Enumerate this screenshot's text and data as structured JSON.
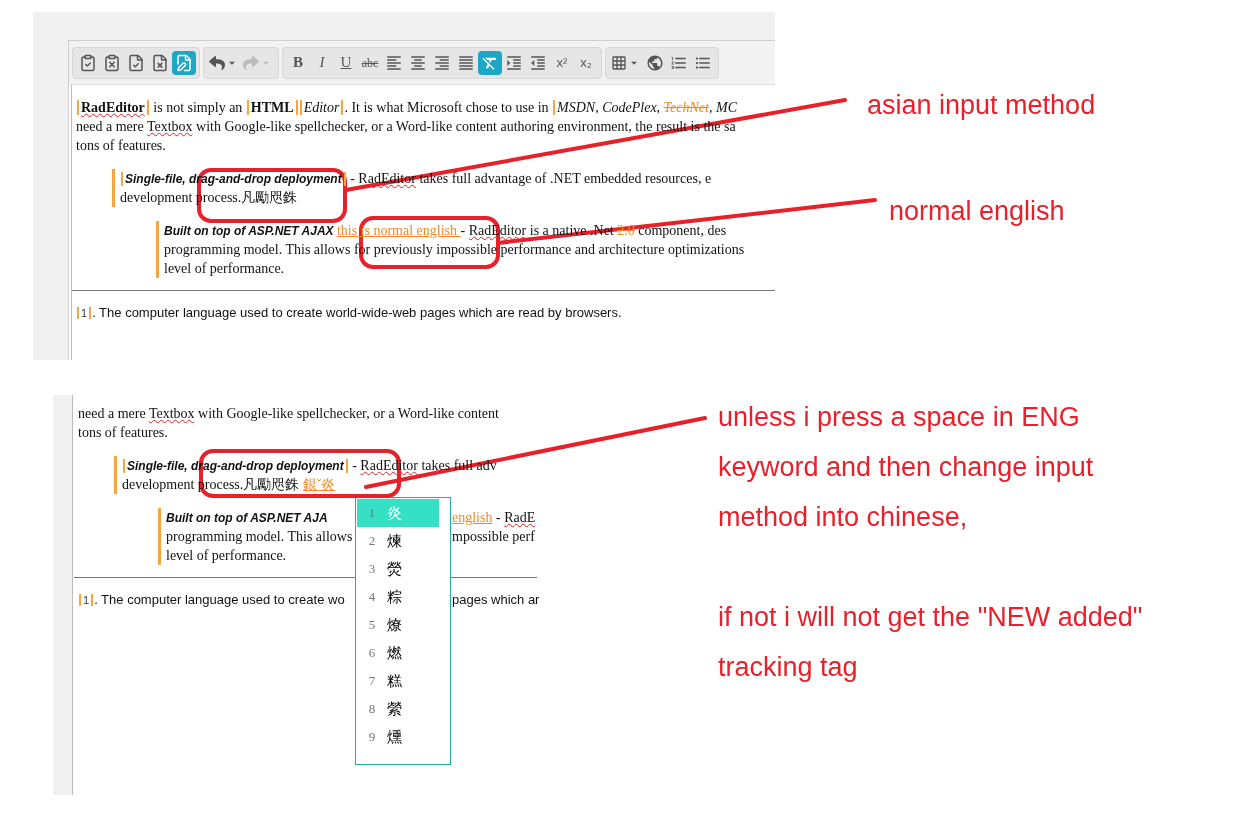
{
  "editor_before": {
    "toolbar": {
      "groups": [
        {
          "tools": [
            {
              "kind": "accept",
              "selected": false
            },
            {
              "kind": "reject",
              "selected": false
            },
            {
              "kind": "accept_all",
              "selected": false
            },
            {
              "kind": "reject_all",
              "selected": false
            },
            {
              "kind": "track",
              "selected": true
            }
          ]
        },
        {
          "tools": [
            {
              "kind": "undo",
              "disabled": false,
              "selected": false
            },
            {
              "kind": "redo",
              "disabled": true,
              "selected": false
            }
          ]
        },
        {
          "tools": [
            {
              "kind": "bold",
              "label": "B",
              "selected": false
            },
            {
              "kind": "italic",
              "label": "I",
              "selected": false
            },
            {
              "kind": "underline",
              "label": "U",
              "selected": false
            },
            {
              "kind": "strike",
              "label": "abc",
              "selected": false
            },
            {
              "kind": "align_left",
              "selected": false
            },
            {
              "kind": "align_center",
              "selected": false
            },
            {
              "kind": "align_right",
              "selected": false
            },
            {
              "kind": "justify",
              "selected": false
            },
            {
              "kind": "clear_format",
              "selected": true
            },
            {
              "kind": "indent",
              "selected": false
            },
            {
              "kind": "outdent",
              "selected": false
            },
            {
              "kind": "superscript",
              "label": "x²",
              "selected": false
            },
            {
              "kind": "subscript",
              "label": "x₂",
              "selected": false
            }
          ]
        },
        {
          "tools": [
            {
              "kind": "table",
              "selected": false
            },
            {
              "kind": "link",
              "selected": false
            },
            {
              "kind": "ordered_list",
              "selected": false
            },
            {
              "kind": "bullet_list",
              "selected": false
            }
          ]
        }
      ]
    },
    "blocks": [
      {
        "kind": "para",
        "lines": [
          {
            "segments": [
              {
                "text": "RadEditor",
                "kind": "strong_misspelled",
                "tag_open": true,
                "tag_close": true
              },
              {
                "text": " is not simply an ",
                "kind": "plain"
              },
              {
                "text": "HTML",
                "kind": "strong",
                "tag_open": true,
                "tag_close": true
              },
              {
                "text": "Editor",
                "kind": "em",
                "tag_open": true,
                "tag_close": true
              },
              {
                "text": ". It is what Microsoft chose to use in ",
                "kind": "plain"
              },
              {
                "text": "MSDN, CodePlex, ",
                "kind": "em",
                "tag_open": true
              },
              {
                "text": "TechNet",
                "kind": "em_deleted"
              },
              {
                "text": ", MC",
                "kind": "em"
              }
            ]
          },
          {
            "segments": [
              {
                "text": "need a mere ",
                "kind": "plain"
              },
              {
                "text": "Textbox",
                "kind": "misspelled"
              },
              {
                "text": " with Google-like spellchecker, or a Word-like content authoring environment, the result is the sa",
                "kind": "plain"
              }
            ]
          },
          {
            "segments": [
              {
                "text": "tons of features.",
                "kind": "plain"
              }
            ]
          }
        ]
      },
      {
        "kind": "quote",
        "lines": [
          {
            "segments": [
              {
                "text": "Single-file, drag-and-drop deployment",
                "kind": "heading",
                "tag_open": true,
                "tag_close": true
              },
              {
                "text": " - ",
                "kind": "plain"
              },
              {
                "text": "RadEditor",
                "kind": "misspelled"
              },
              {
                "text": " takes full advantage of .NET embedded resources, e",
                "kind": "plain"
              }
            ]
          },
          {
            "segments": [
              {
                "text": "development process.凡勵咫銖",
                "kind": "plain"
              }
            ]
          }
        ],
        "children": [
          {
            "kind": "quote",
            "lines": [
              {
                "segments": [
                  {
                    "text": "Built on top of ASP.NET AJAX ",
                    "kind": "heading"
                  },
                  {
                    "text": "this is normal english ",
                    "kind": "inserted"
                  },
                  {
                    "text": "- ",
                    "kind": "plain"
                  },
                  {
                    "text": "RadEditor",
                    "kind": "misspelled"
                  },
                  {
                    "text": " is a native .Net ",
                    "kind": "plain"
                  },
                  {
                    "text": "2.0",
                    "kind": "deleted"
                  },
                  {
                    "text": " component, des",
                    "kind": "plain"
                  }
                ]
              },
              {
                "segments": [
                  {
                    "text": "programming model. This allows for previously impossible performance and architecture optimizations",
                    "kind": "plain"
                  }
                ]
              },
              {
                "segments": [
                  {
                    "text": "level of performance.",
                    "kind": "plain"
                  }
                ]
              }
            ]
          }
        ]
      },
      {
        "kind": "rule"
      },
      {
        "kind": "para",
        "lines": [
          {
            "segments": [
              {
                "text": "1",
                "kind": "ref",
                "tag_open": true,
                "tag_close": true
              },
              {
                "text": ". The computer language used to create world-wide-web pages which are read by browsers.",
                "kind": "sans"
              }
            ]
          }
        ]
      }
    ]
  },
  "editor_after": {
    "blocks": [
      {
        "kind": "para",
        "lines": [
          {
            "segments": [
              {
                "text": "need a mere ",
                "kind": "plain"
              },
              {
                "text": "Textbox",
                "kind": "misspelled"
              },
              {
                "text": " with Google-like spellchecker, or a Word-like content",
                "kind": "plain"
              }
            ]
          },
          {
            "segments": [
              {
                "text": "tons of features.",
                "kind": "plain"
              }
            ]
          }
        ]
      },
      {
        "kind": "quote",
        "lines": [
          {
            "segments": [
              {
                "text": "Single-file, drag-and-drop deployment",
                "kind": "heading",
                "tag_open": true,
                "tag_close": true
              },
              {
                "text": " - ",
                "kind": "plain"
              },
              {
                "text": "RadEditor",
                "kind": "misspelled"
              },
              {
                "text": " takes full adv",
                "kind": "plain"
              }
            ]
          },
          {
            "segments": [
              {
                "text": "development process.凡勵咫銖 ",
                "kind": "plain"
              },
              {
                "text": "銀ˇ炎",
                "kind": "ime"
              }
            ]
          }
        ],
        "children": [
          {
            "kind": "quote",
            "lines": [
              {
                "segments": [
                  {
                    "text": "Built on top of ASP.NET AJA",
                    "kind": "heading"
                  }
                ],
                "after": [
                  {
                    "text": "english",
                    "kind": "inserted"
                  },
                  {
                    "text": " - ",
                    "kind": "plain"
                  },
                  {
                    "text": "RadE",
                    "kind": "misspelled"
                  }
                ]
              },
              {
                "segments": [
                  {
                    "text": "programming model. This allows",
                    "kind": "plain"
                  }
                ],
                "after": [
                  {
                    "text": "mpossible perf",
                    "kind": "plain"
                  }
                ]
              },
              {
                "segments": [
                  {
                    "text": "level of performance.",
                    "kind": "plain"
                  }
                ]
              }
            ]
          }
        ]
      },
      {
        "kind": "rule"
      },
      {
        "kind": "para",
        "lines": [
          {
            "segments": [
              {
                "text": "1",
                "kind": "ref",
                "tag_open": true,
                "tag_close": true
              },
              {
                "text": ". The computer language used to create wo",
                "kind": "sans"
              }
            ],
            "after": [
              {
                "text": "pages which ar",
                "kind": "sans"
              }
            ]
          }
        ]
      }
    ],
    "candidates": [
      {
        "number": "1",
        "text": "炎",
        "selected": true
      },
      {
        "number": "2",
        "text": "煉",
        "selected": false
      },
      {
        "number": "3",
        "text": "熒",
        "selected": false
      },
      {
        "number": "4",
        "text": "粽",
        "selected": false
      },
      {
        "number": "5",
        "text": "燎",
        "selected": false
      },
      {
        "number": "6",
        "text": "燃",
        "selected": false
      },
      {
        "number": "7",
        "text": "糕",
        "selected": false
      },
      {
        "number": "8",
        "text": "縈",
        "selected": false
      },
      {
        "number": "9",
        "text": "燻",
        "selected": false
      }
    ]
  },
  "notes": [
    {
      "lines": [
        "asian input method"
      ]
    },
    {
      "lines": [
        "normal english"
      ]
    },
    {
      "lines": [
        "unless i press a space in ENG",
        "keyword and then change input",
        "method into chinese,"
      ]
    },
    {
      "lines": [
        "if not i will not get the \"NEW added\"",
        "tracking tag"
      ]
    }
  ]
}
